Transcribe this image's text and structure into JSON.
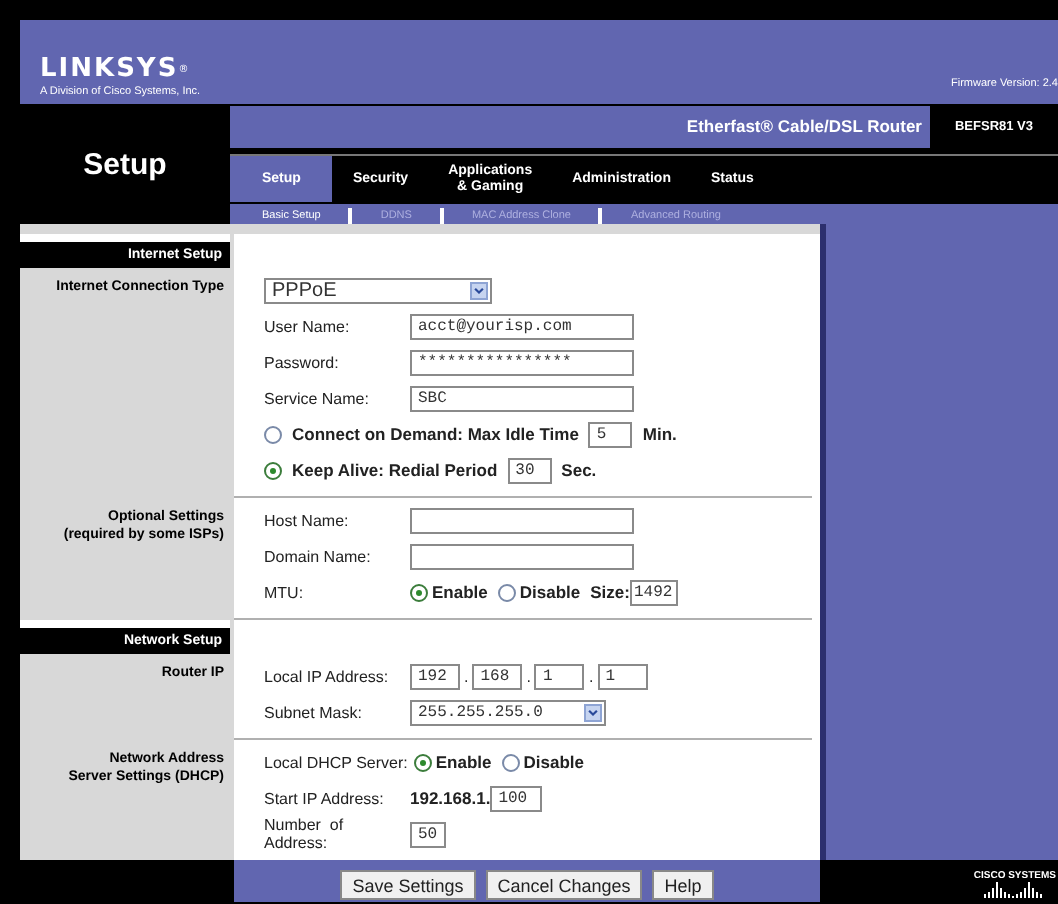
{
  "header": {
    "logo": "LINKSYS",
    "logo_mark": "®",
    "tagline": "A Division of Cisco Systems, Inc.",
    "firmware": "Firmware Version: 2.4"
  },
  "page_title": "Setup",
  "product": {
    "name": "Etherfast® Cable/DSL Router",
    "model": "BEFSR81 V3"
  },
  "tabs": [
    {
      "label": "Setup",
      "selected": true
    },
    {
      "label": "Security",
      "selected": false
    },
    {
      "label": "Applications\n& Gaming",
      "selected": false
    },
    {
      "label": "Administration",
      "selected": false
    },
    {
      "label": "Status",
      "selected": false
    }
  ],
  "subtabs": [
    {
      "label": "Basic Setup",
      "selected": true
    },
    {
      "label": "DDNS",
      "selected": false
    },
    {
      "label": "MAC Address Clone",
      "selected": false
    },
    {
      "label": "Advanced Routing",
      "selected": false
    }
  ],
  "sections": [
    {
      "kind": "heading",
      "label": "Internet Setup"
    },
    {
      "kind": "group",
      "label": "Internet Connection Type",
      "fields": [
        {
          "kind": "select",
          "value": "PPPoE"
        },
        {
          "kind": "text",
          "label": "User Name:",
          "value": "acct@yourisp.com"
        },
        {
          "kind": "text",
          "label": "Password:",
          "value": "****************"
        },
        {
          "kind": "text",
          "label": "Service Name:",
          "value": "SBC"
        },
        {
          "kind": "radio-line",
          "selected": false,
          "label": "Connect on Demand: Max Idle Time",
          "value": "5",
          "unit": "Min."
        },
        {
          "kind": "radio-line",
          "selected": true,
          "label": "Keep Alive: Redial Period",
          "value": "30",
          "unit": "Sec."
        }
      ]
    },
    {
      "kind": "group",
      "label": "Optional Settings\n(required by some ISPs)",
      "fields": [
        {
          "kind": "text",
          "label": "Host Name:"
        },
        {
          "kind": "text",
          "label": "Domain Name:"
        },
        {
          "kind": "radios",
          "label": "MTU:",
          "options": [
            {
              "label": "Enable",
              "selected": true
            },
            {
              "label": "Disable",
              "selected": false
            }
          ],
          "extra_label": "Size:",
          "extra_value": "1492"
        }
      ]
    },
    {
      "kind": "heading",
      "label": "Network Setup"
    },
    {
      "kind": "group",
      "label": "Router IP",
      "fields": [
        {
          "kind": "ip",
          "label": "Local IP Address:",
          "octets": [
            "192",
            "168",
            "1",
            "1"
          ],
          "separator": "."
        },
        {
          "kind": "select",
          "label": "Subnet Mask:",
          "value": "255.255.255.0"
        }
      ]
    },
    {
      "kind": "group",
      "label": "Network Address\nServer Settings (DHCP)",
      "fields": [
        {
          "kind": "radios",
          "label": "Local DHCP Server:",
          "options": [
            {
              "label": "Enable",
              "selected": true
            },
            {
              "label": "Disable",
              "selected": false
            }
          ]
        },
        {
          "kind": "prefixed",
          "label": "Start IP Address:",
          "prefix": "192.168.1.",
          "value": "100"
        },
        {
          "kind": "short",
          "label": "Number  of\nAddress:",
          "value": "50"
        }
      ]
    }
  ],
  "buttons": [
    "Save Settings",
    "Cancel Changes",
    "Help"
  ],
  "brand": "CISCO SYSTEMS"
}
